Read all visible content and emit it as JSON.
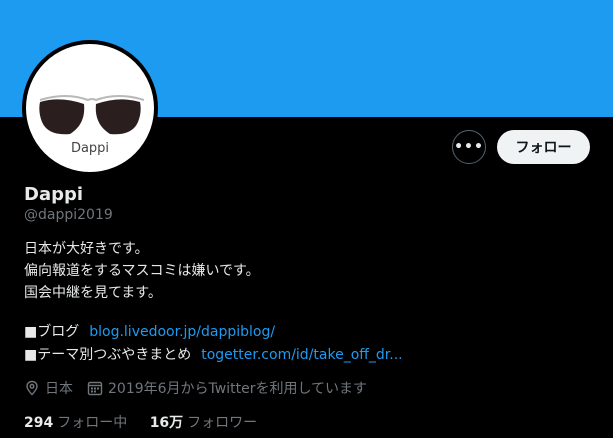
{
  "profile": {
    "avatar_caption": "Dappi",
    "name": "Dappi",
    "handle": "@dappi2019",
    "bio_lines": [
      "日本が大好きです。",
      "偏向報道をするマスコミは嫌いです。",
      "国会中継を見てます。"
    ],
    "links": [
      {
        "label": "■ブログ",
        "url_text": "blog.livedoor.jp/dappiblog/"
      },
      {
        "label": "■テーマ別つぶやきまとめ",
        "url_text": "togetter.com/id/take_off_dr..."
      }
    ],
    "location": "日本",
    "joined": "2019年6月からTwitterを利用しています",
    "following_count": "294",
    "following_label": "フォロー中",
    "followers_count": "16万",
    "followers_label": "フォロワー"
  },
  "actions": {
    "more_label": "•••",
    "follow_label": "フォロー"
  },
  "icons": {
    "more": "more-icon",
    "location": "location-pin-icon",
    "calendar": "calendar-icon"
  },
  "colors": {
    "banner": "#1d9bf0",
    "link": "#1d9bf0",
    "muted": "#71767b",
    "background": "#000000"
  }
}
